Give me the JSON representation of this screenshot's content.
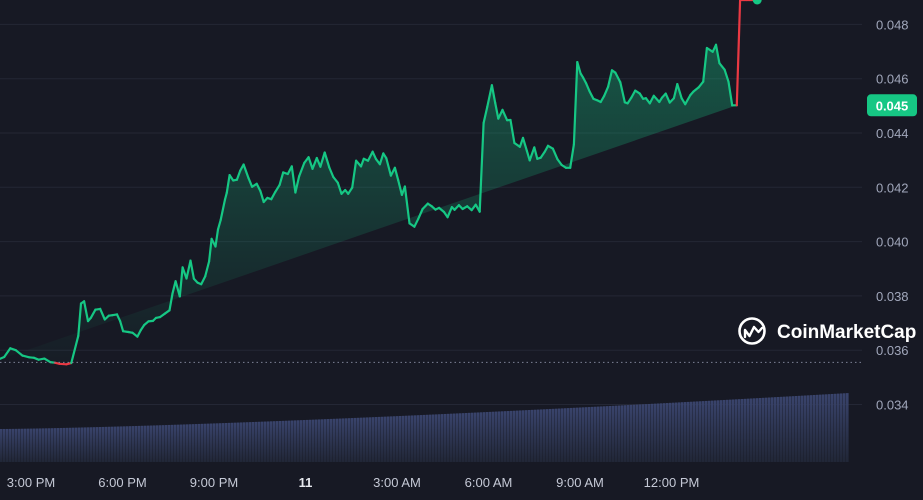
{
  "chart_data": {
    "type": "area",
    "title": "",
    "xlabel": "",
    "ylabel": "",
    "ylim": [
      0.0325,
      0.049
    ],
    "grid": true,
    "x_ticks": [
      "3:00 PM",
      "6:00 PM",
      "9:00 PM",
      "11",
      "3:00 AM",
      "6:00 AM",
      "9:00 AM",
      "12:00 PM"
    ],
    "y_ticks": [
      "0.034",
      "0.036",
      "0.038",
      "0.040",
      "0.042",
      "0.044",
      "0.046",
      "0.048"
    ],
    "reference_price": 0.03555,
    "current_price": 0.04502,
    "current_price_label": "0.045",
    "colors": {
      "up": "#16c784",
      "down": "#ea3943",
      "background": "#171924",
      "grid": "#262935"
    },
    "x_unit": "hours since 3:00 PM",
    "series": [
      {
        "values_x": [
          -1.3,
          -1.09,
          -0.88,
          -0.68,
          -0.5,
          -0.28,
          -0.06,
          0.1,
          0.25,
          0.44,
          0.63,
          0.78,
          0.93,
          1.16,
          1.32,
          1.55,
          1.64,
          1.74,
          1.87,
          1.96,
          2.11,
          2.27,
          2.42,
          2.55,
          2.67,
          2.82,
          2.92,
          3.02,
          3.19,
          3.33,
          3.49,
          3.6,
          3.71,
          3.85,
          4.0,
          4.1,
          4.23,
          4.38,
          4.54,
          4.64,
          4.74,
          4.88,
          4.97,
          5.1,
          5.23,
          5.34,
          5.46,
          5.58,
          5.71,
          5.84,
          5.92,
          6.05,
          6.13,
          6.22,
          6.36,
          6.42,
          6.51,
          6.63,
          6.75,
          6.86,
          6.97,
          7.13,
          7.25,
          7.4,
          7.52,
          7.63,
          7.75,
          7.88,
          8.01,
          8.15,
          8.27,
          8.42,
          8.55,
          8.67,
          8.79,
          8.96,
          9.1,
          9.23,
          9.37,
          9.49,
          9.63,
          9.78,
          9.91,
          10.06,
          10.18,
          10.3,
          10.4,
          10.53,
          10.66,
          10.82,
          10.91,
          11.05,
          11.2,
          11.31,
          11.44,
          11.55,
          11.65,
          11.8,
          11.93,
          12.04,
          12.16,
          12.26,
          12.41,
          12.57,
          12.7,
          12.84,
          13.01,
          13.14,
          13.26,
          13.38,
          13.54,
          13.66,
          13.8,
          13.89,
          14.03,
          14.15,
          14.3,
          14.45,
          14.58,
          14.71,
          14.84,
          14.96,
          15.11,
          15.22,
          15.32,
          15.46,
          15.61,
          15.72,
          15.85,
          16.03,
          16.13,
          16.26,
          16.35,
          16.5,
          16.6,
          16.71,
          16.85,
          16.95,
          17.11,
          17.26,
          17.4,
          17.54,
          17.68,
          17.8,
          17.91,
          18.02,
          18.1,
          18.2,
          18.31,
          18.44,
          18.57,
          18.68,
          18.79,
          18.92,
          19.05,
          19.16,
          19.32,
          19.47,
          19.56,
          19.69,
          19.81,
          19.96,
          20.07,
          20.16,
          20.29,
          20.42,
          20.6,
          20.69,
          20.81,
          20.94,
          21.08,
          21.19,
          21.33,
          21.45,
          21.62,
          21.72,
          21.89,
          22.04,
          22.16,
          22.35,
          22.46,
          22.57,
          22.74,
          22.87,
          22.99,
          23.14,
          23.25,
          23.38,
          23.46,
          23.57,
          23.74,
          23.81
        ],
        "values": [
          0.0357,
          0.03565,
          0.03575,
          0.03607,
          0.036,
          0.0358,
          0.03574,
          0.03572,
          0.03565,
          0.03569,
          0.03556,
          0.03554,
          0.0355,
          0.03548,
          0.03553,
          0.03653,
          0.03772,
          0.0378,
          0.03707,
          0.03719,
          0.03749,
          0.03752,
          0.03713,
          0.03727,
          0.03729,
          0.03732,
          0.03707,
          0.0367,
          0.03667,
          0.03664,
          0.0365,
          0.03674,
          0.03693,
          0.03706,
          0.03708,
          0.03719,
          0.03722,
          0.03734,
          0.03747,
          0.03809,
          0.03854,
          0.03798,
          0.03905,
          0.03864,
          0.0393,
          0.03863,
          0.03849,
          0.03843,
          0.03872,
          0.03927,
          0.0401,
          0.03982,
          0.04045,
          0.0408,
          0.04155,
          0.0418,
          0.04245,
          0.04225,
          0.04228,
          0.04261,
          0.04284,
          0.04234,
          0.04202,
          0.04213,
          0.04186,
          0.04146,
          0.04161,
          0.04156,
          0.04183,
          0.04209,
          0.04255,
          0.04249,
          0.04277,
          0.04181,
          0.0424,
          0.0429,
          0.04311,
          0.04268,
          0.04308,
          0.04276,
          0.04328,
          0.04273,
          0.04238,
          0.04217,
          0.04176,
          0.0419,
          0.04176,
          0.04199,
          0.04298,
          0.04277,
          0.04305,
          0.04298,
          0.04331,
          0.04304,
          0.04285,
          0.04325,
          0.04307,
          0.04243,
          0.04272,
          0.04226,
          0.04172,
          0.04203,
          0.04067,
          0.04055,
          0.04084,
          0.0412,
          0.0414,
          0.0413,
          0.04118,
          0.04124,
          0.04109,
          0.0409,
          0.04127,
          0.04117,
          0.04134,
          0.0412,
          0.0413,
          0.04116,
          0.04136,
          0.0411,
          0.04437,
          0.04497,
          0.04576,
          0.04511,
          0.04453,
          0.04485,
          0.04447,
          0.04448,
          0.04363,
          0.04349,
          0.04382,
          0.04334,
          0.04299,
          0.04347,
          0.04305,
          0.04309,
          0.04332,
          0.04353,
          0.04342,
          0.04304,
          0.04282,
          0.04272,
          0.04272,
          0.04358,
          0.04661,
          0.04619,
          0.04604,
          0.04583,
          0.04554,
          0.04526,
          0.0452,
          0.04514,
          0.04536,
          0.0457,
          0.04631,
          0.04622,
          0.04587,
          0.04513,
          0.04509,
          0.04531,
          0.04556,
          0.04545,
          0.04526,
          0.04528,
          0.04509,
          0.04537,
          0.04514,
          0.0453,
          0.04545,
          0.04512,
          0.04528,
          0.0458,
          0.04528,
          0.04506,
          0.0454,
          0.04553,
          0.04568,
          0.04589,
          0.04713,
          0.04699,
          0.04725,
          0.04657,
          0.04633,
          0.04589,
          0.04502,
          0.04502
        ],
        "volume_bars": "cumulative, rising from left to right"
      }
    ]
  },
  "watermark": {
    "text": "CoinMarketCap",
    "icon": "coinmarketcap-logo-icon"
  },
  "price_badge": {
    "text": "0.045"
  }
}
